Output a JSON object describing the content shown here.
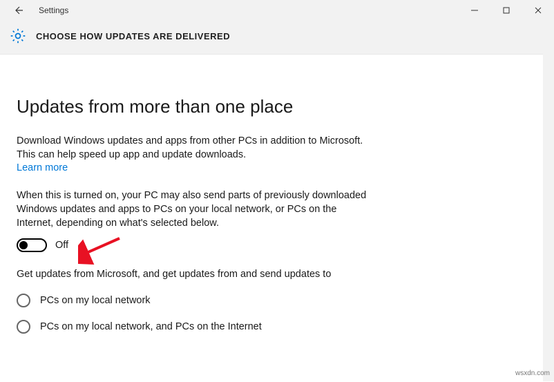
{
  "window": {
    "app_title": "Settings"
  },
  "header": {
    "title": "CHOOSE HOW UPDATES ARE DELIVERED"
  },
  "main": {
    "heading": "Updates from more than one place",
    "intro": "Download Windows updates and apps from other PCs in addition to Microsoft. This can help speed up app and update downloads.",
    "learn_more": "Learn more",
    "explanation": "When this is turned on, your PC may also send parts of previously downloaded Windows updates and apps to PCs on your local network, or PCs on the Internet, depending on what's selected below.",
    "toggle": {
      "state_label": "Off",
      "on": false
    },
    "radio_intro": "Get updates from Microsoft, and get updates from and send updates to",
    "radios": [
      {
        "label": "PCs on my local network"
      },
      {
        "label": "PCs on my local network, and PCs on the Internet"
      }
    ]
  },
  "watermark": "wsxdn.com"
}
